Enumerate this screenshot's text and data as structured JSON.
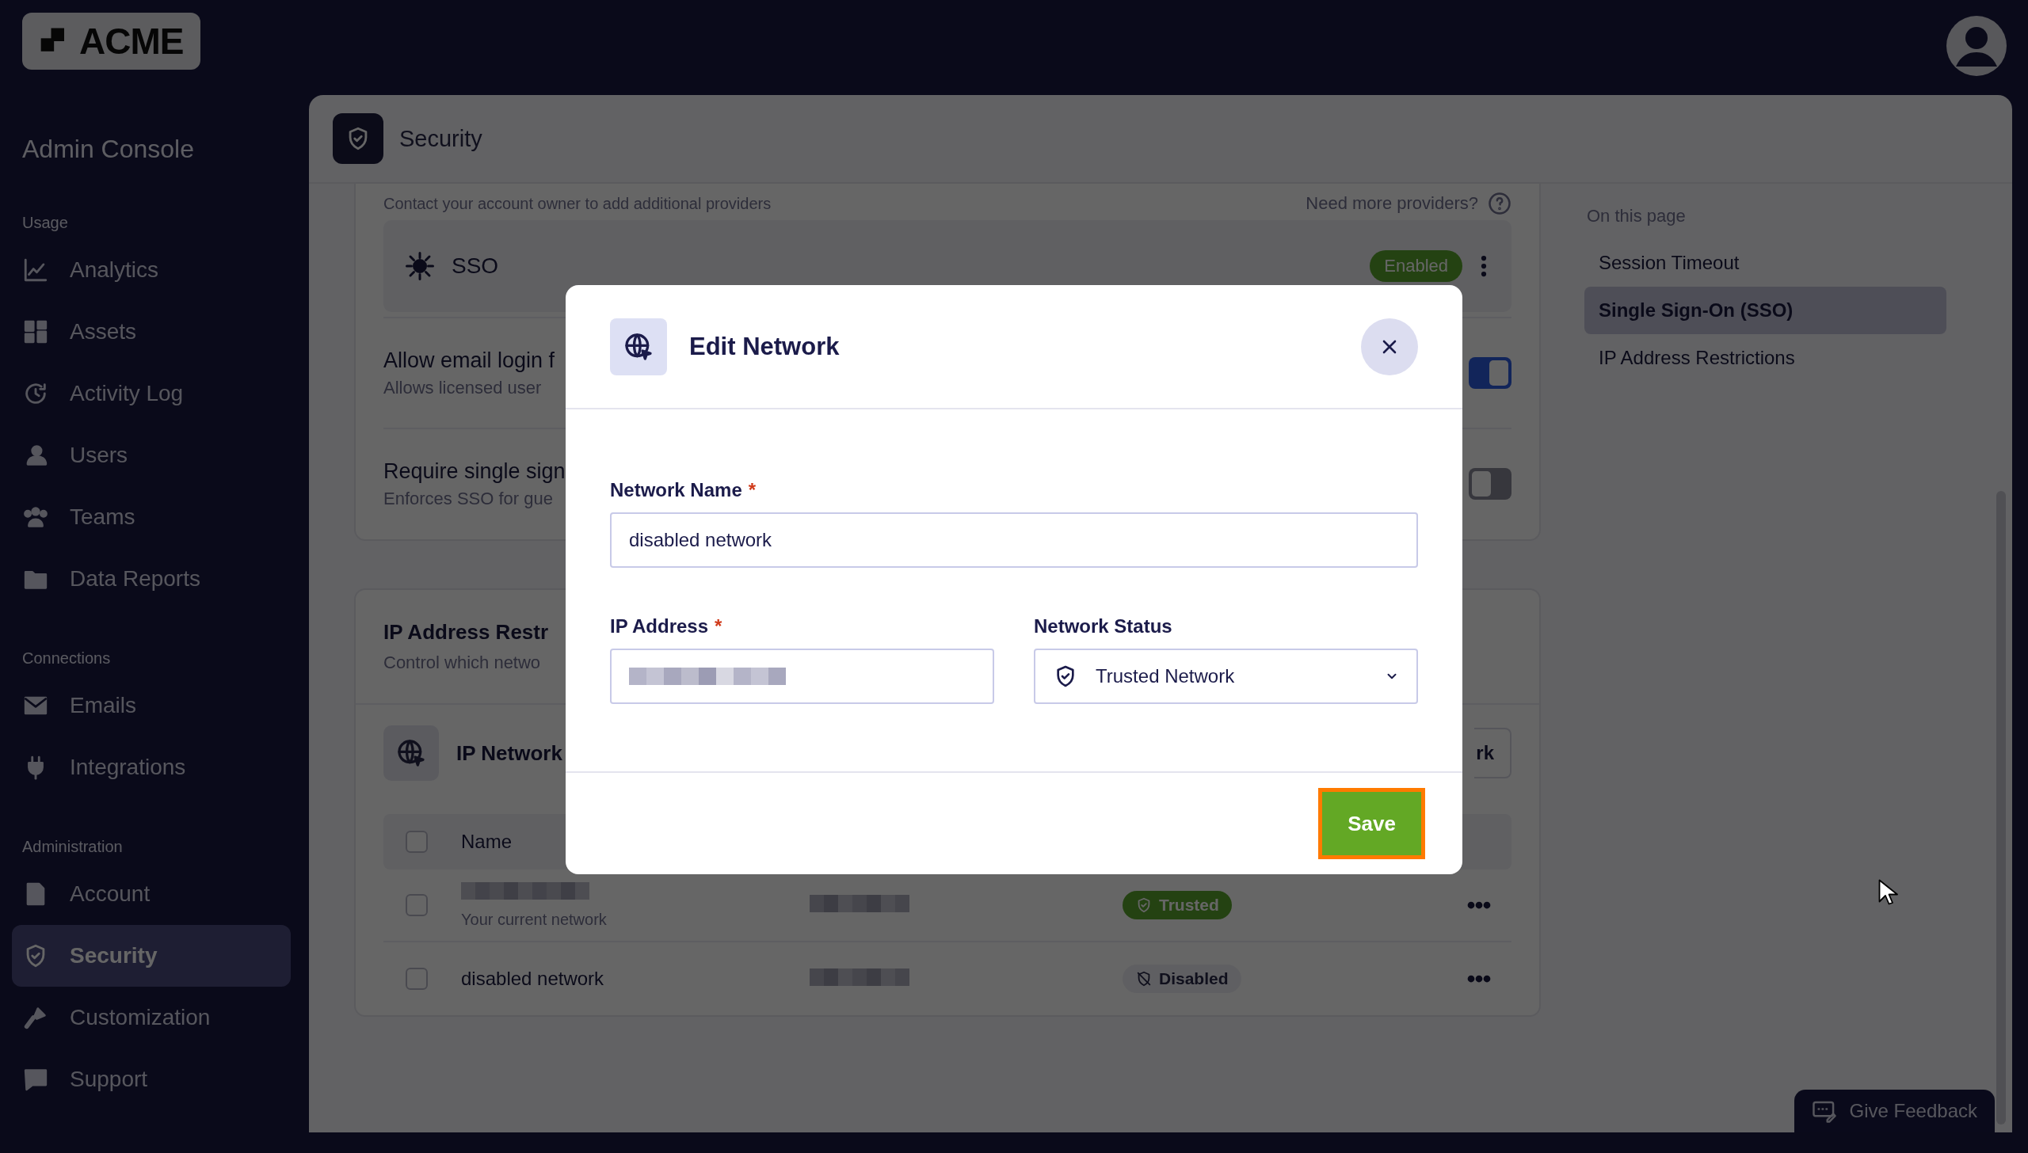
{
  "brand": {
    "logo": "ACME"
  },
  "sidebar": {
    "title": "Admin Console",
    "sections": [
      {
        "label": "Usage",
        "items": [
          {
            "label": "Analytics",
            "selected": false
          },
          {
            "label": "Assets",
            "selected": false
          },
          {
            "label": "Activity Log",
            "selected": false
          },
          {
            "label": "Users",
            "selected": false
          },
          {
            "label": "Teams",
            "selected": false
          },
          {
            "label": "Data Reports",
            "selected": false
          }
        ]
      },
      {
        "label": "Connections",
        "items": [
          {
            "label": "Emails",
            "selected": false
          },
          {
            "label": "Integrations",
            "selected": false
          }
        ]
      },
      {
        "label": "Administration",
        "items": [
          {
            "label": "Account",
            "selected": false
          },
          {
            "label": "Security",
            "selected": true
          },
          {
            "label": "Customization",
            "selected": false
          },
          {
            "label": "Support",
            "selected": false
          }
        ]
      }
    ]
  },
  "page": {
    "title": "Security"
  },
  "sso_card": {
    "hint": "Contact your account owner to add additional providers",
    "help_link": "Need more providers?",
    "provider": {
      "name": "SSO",
      "status": "Enabled"
    },
    "settings": [
      {
        "title": "Allow email login f",
        "description": "Allows licensed user",
        "on": true
      },
      {
        "title": "Require single sign",
        "description": "Enforces SSO for gue",
        "on": false
      }
    ]
  },
  "ip_card": {
    "title": "IP Address Restr",
    "description": "Control which netwo",
    "subheader": {
      "title": "IP Network",
      "button": "rk"
    },
    "table": {
      "columns": [
        "Name"
      ],
      "header_checked": false,
      "rows": [
        {
          "checked": false,
          "note": "Your current network",
          "status": {
            "label": "Trusted",
            "kind": "trusted"
          }
        },
        {
          "checked": false,
          "name": "disabled network",
          "status": {
            "label": "Disabled",
            "kind": "disabled"
          }
        }
      ]
    }
  },
  "toc": {
    "title": "On this page",
    "items": [
      {
        "label": "Session Timeout",
        "selected": false
      },
      {
        "label": "Single Sign-On (SSO)",
        "selected": true
      },
      {
        "label": "IP Address Restrictions",
        "selected": false
      }
    ]
  },
  "feedback": {
    "label": "Give Feedback"
  },
  "modal": {
    "title": "Edit Network",
    "fields": [
      {
        "kind": "text",
        "label": "Network Name",
        "required_mark": "*",
        "value": "disabled network"
      },
      {
        "kind": "redacted",
        "label": "IP Address",
        "required_mark": "*"
      },
      {
        "kind": "select",
        "label": "Network Status",
        "value": "Trusted Network"
      }
    ],
    "buttons": [
      {
        "label": "Save",
        "highlighted": true
      }
    ]
  }
}
